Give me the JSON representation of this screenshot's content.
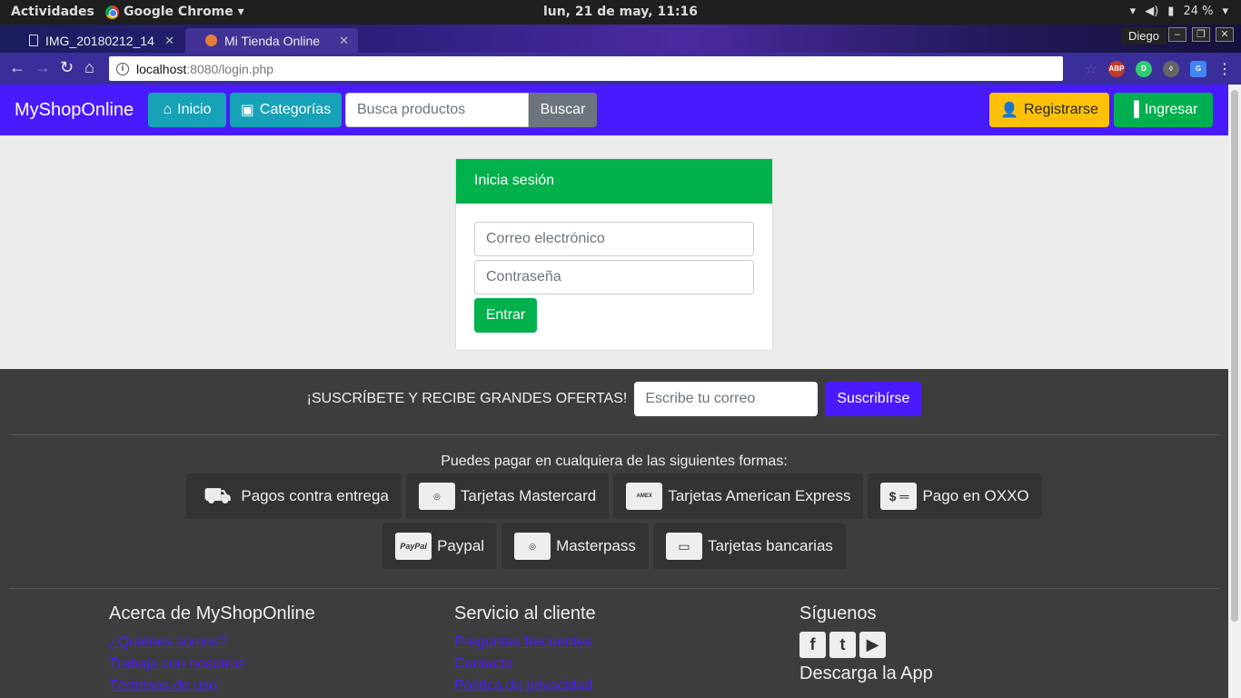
{
  "os": {
    "activities": "Actividades",
    "app": "Google Chrome ▾",
    "clock": "lun, 21 de may, 11:16",
    "battery": "24 %"
  },
  "browser": {
    "tabs": [
      {
        "label": "IMG_20180212_14"
      },
      {
        "label": "Mi Tienda Online"
      }
    ],
    "profile": "Diego",
    "url_host": "localhost",
    "url_rest": ":8080/login.php"
  },
  "navbar": {
    "brand": "MyShopOnline",
    "inicio": "Inicio",
    "categorias": "Categorías",
    "search_placeholder": "Busca productos",
    "buscar": "Buscar",
    "registrarse": "Registrarse",
    "ingresar": "Ingresar"
  },
  "login": {
    "title": "Inicia sesión",
    "email_placeholder": "Correo electrónico",
    "password_placeholder": "Contraseña",
    "submit": "Entrar"
  },
  "footer": {
    "subscribe_label": "¡SUSCRÍBETE Y RECIBE GRANDES OFERTAS!",
    "subscribe_placeholder": "Escribe tu correo",
    "subscribe_button": "Suscribírse",
    "payments_title": "Puedes pagar en cualquiera de las siguientes formas:",
    "payments_row1": [
      {
        "label": "Pagos contra entrega"
      },
      {
        "label": "Tarjetas Mastercard"
      },
      {
        "label": "Tarjetas American Express"
      },
      {
        "label": "Pago en OXXO"
      }
    ],
    "payments_row2": [
      {
        "label": "Paypal"
      },
      {
        "label": "Masterpass"
      },
      {
        "label": "Tarjetas bancarias"
      }
    ],
    "about": {
      "title": "Acerca de MyShopOnline",
      "links": [
        "¿Quiénes somos?",
        "Trabaja con nosotros",
        "Términos de uso"
      ]
    },
    "service": {
      "title": "Servicio al cliente",
      "links": [
        "Preguntas frecuentes",
        "Contacto",
        "Política de privacidad"
      ]
    },
    "follow": {
      "title": "Síguenos",
      "app_title": "Descarga la App"
    }
  }
}
